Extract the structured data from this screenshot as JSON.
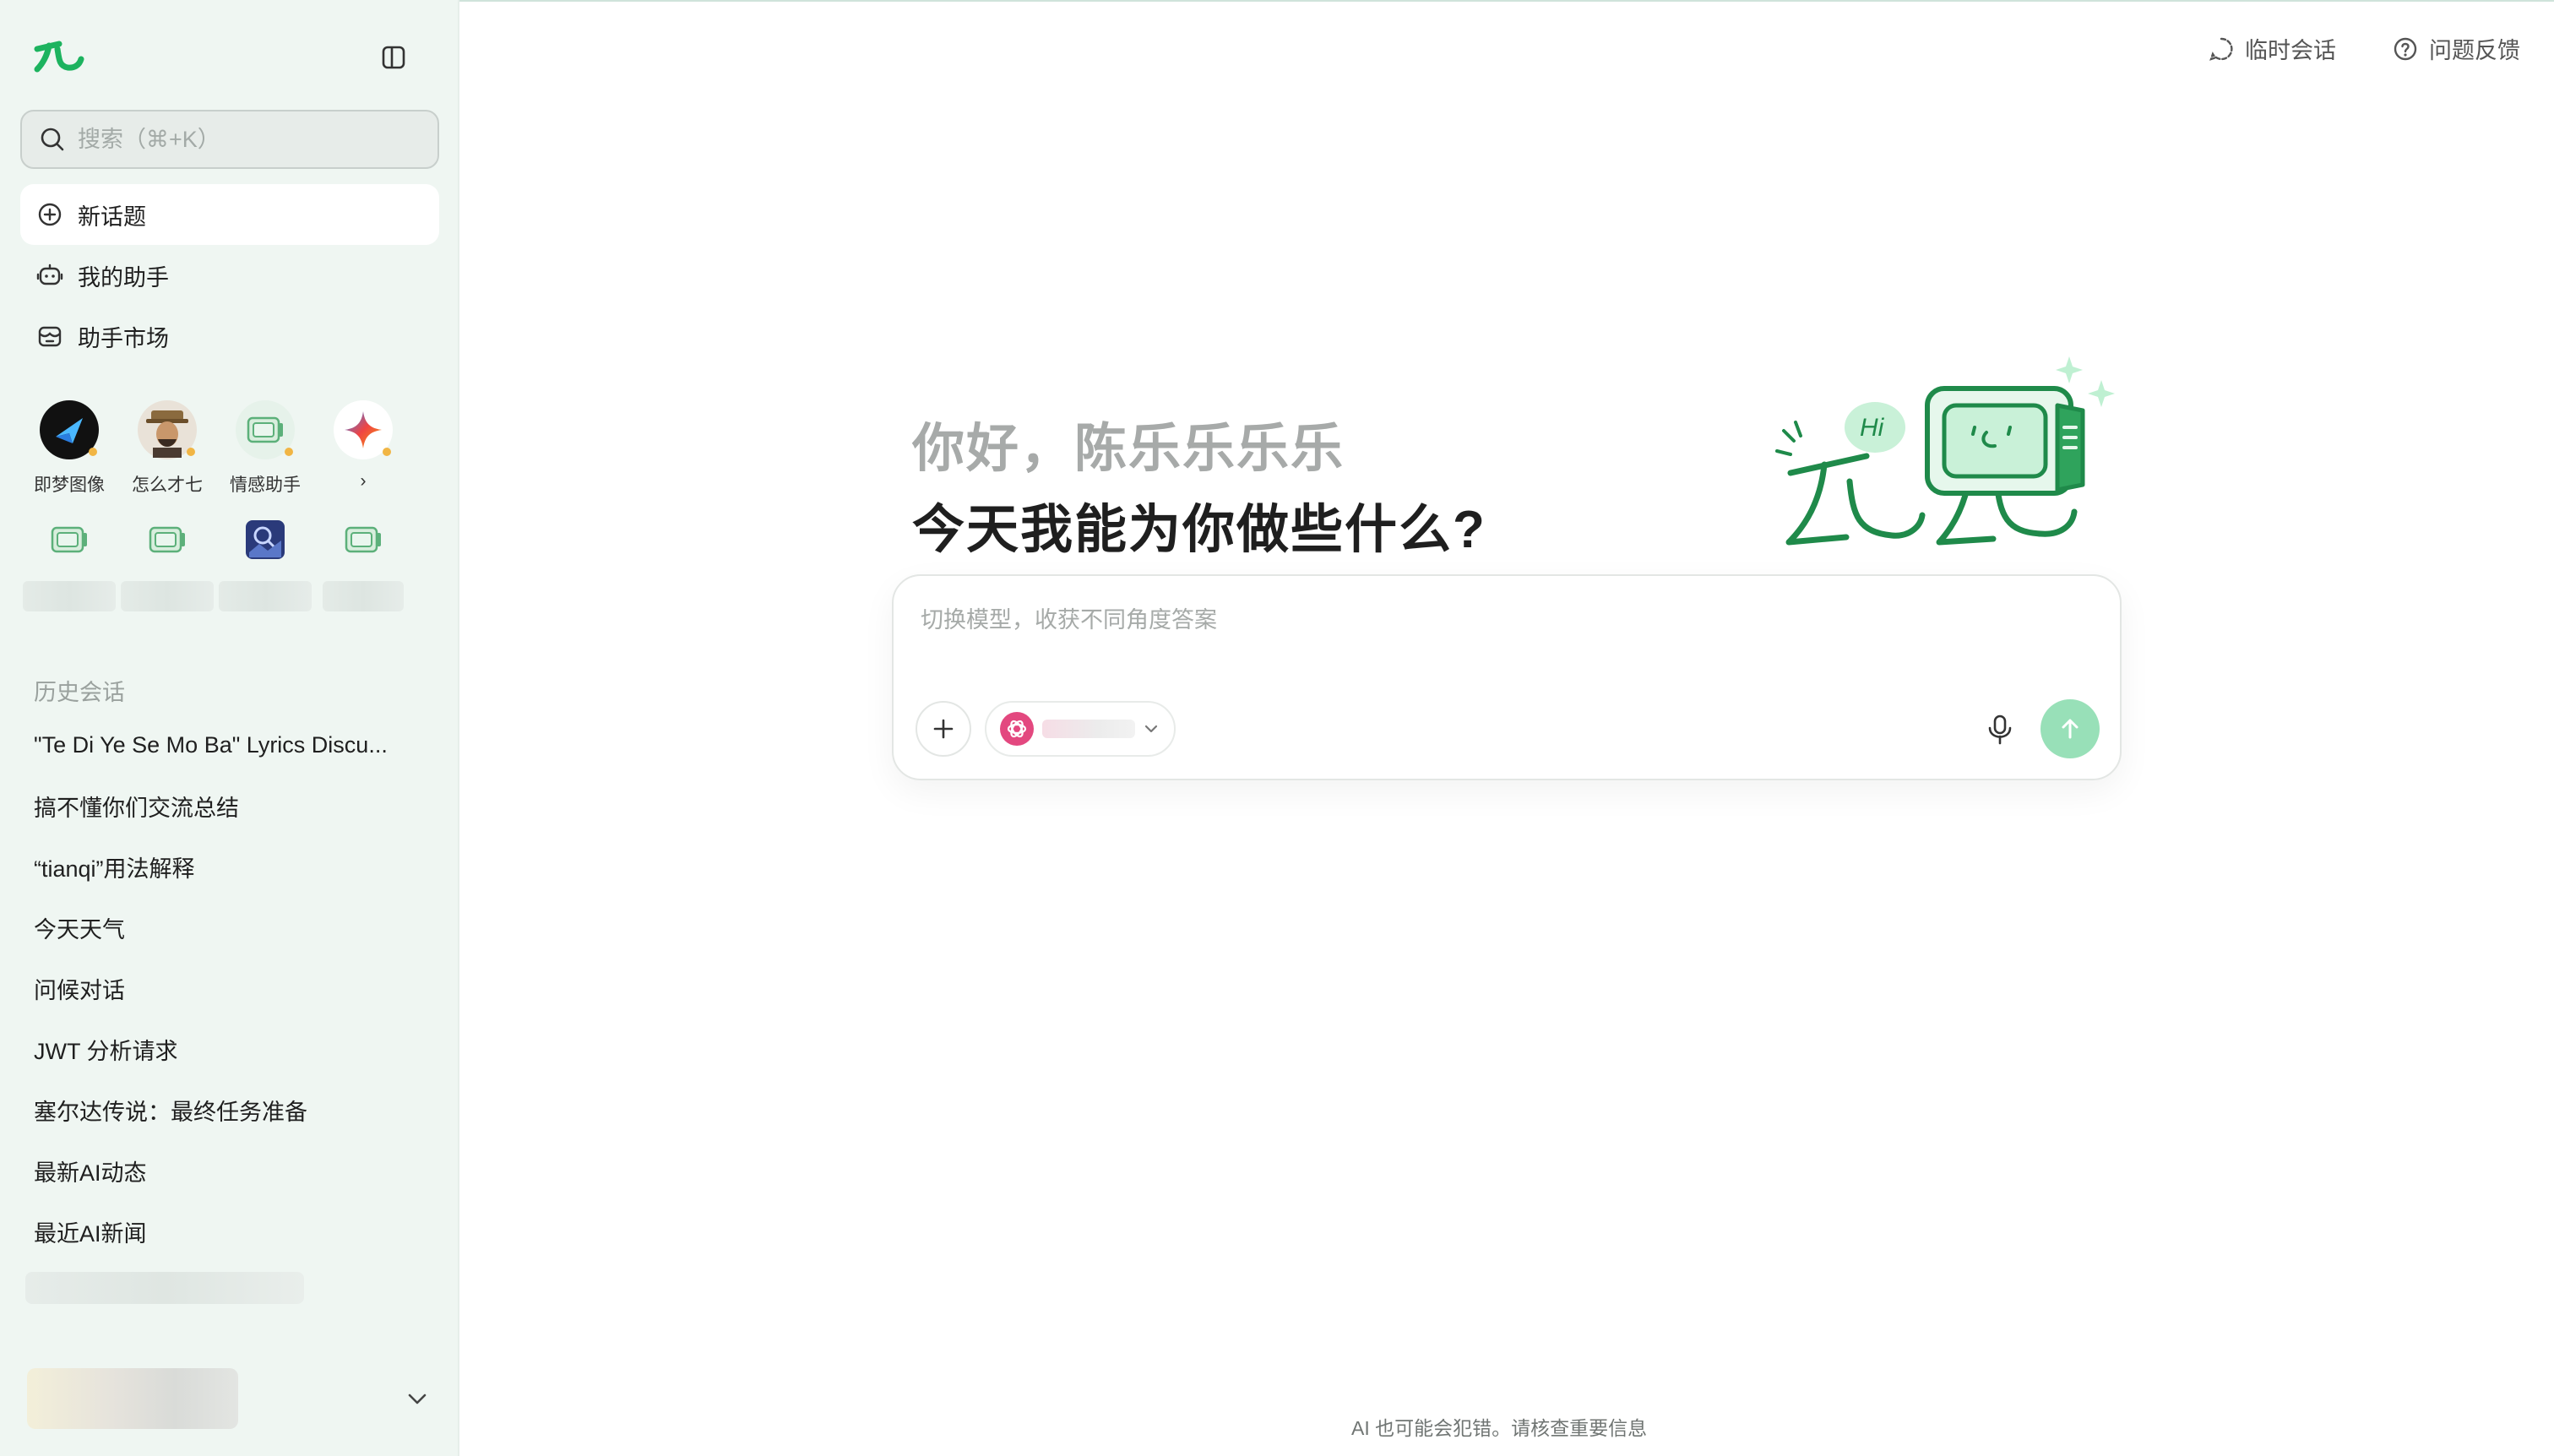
{
  "colors": {
    "brand": "#1db35f",
    "sidebar_bg": "#eff6f2",
    "send_button": "#98e0b8",
    "muted": "#a7aaa9"
  },
  "sidebar": {
    "toggle_icon": "panel-left-icon",
    "search": {
      "placeholder": "搜索（⌘+K）"
    },
    "nav": [
      {
        "label": "新话题",
        "icon": "plus-circle-icon"
      },
      {
        "label": "我的助手",
        "icon": "robot-icon"
      },
      {
        "label": "助手市场",
        "icon": "store-icon"
      }
    ],
    "assistants": [
      {
        "label": "即梦图像",
        "icon": "jimeng-logo-icon"
      },
      {
        "label": "怎么才七",
        "icon": "avatar-photo-icon"
      },
      {
        "label": "情感助手",
        "icon": "robot-tv-icon"
      },
      {
        "label": "›",
        "icon": "gemini-star-icon"
      }
    ],
    "history_title": "历史会话",
    "history": [
      "\"Te Di Ye Se Mo Ba\" Lyrics Discu...",
      "搞不懂你们交流总结",
      "“tianqi”用法解释",
      "今天天气",
      "问候对话",
      "JWT 分析请求",
      "塞尔达传说：最终任务准备",
      "最新AI动态",
      "最近AI新闻"
    ]
  },
  "header": {
    "temp_chat": "临时会话",
    "feedback": "问题反馈"
  },
  "main": {
    "greeting_line1": "你好，陈乐乐乐乐",
    "greeting_line2": "今天我能为你做些什么?",
    "illustration_badge": "Hi",
    "composer": {
      "placeholder": "切换模型，收获不同角度答案"
    },
    "disclaimer": "AI 也可能会犯错。请核查重要信息"
  }
}
